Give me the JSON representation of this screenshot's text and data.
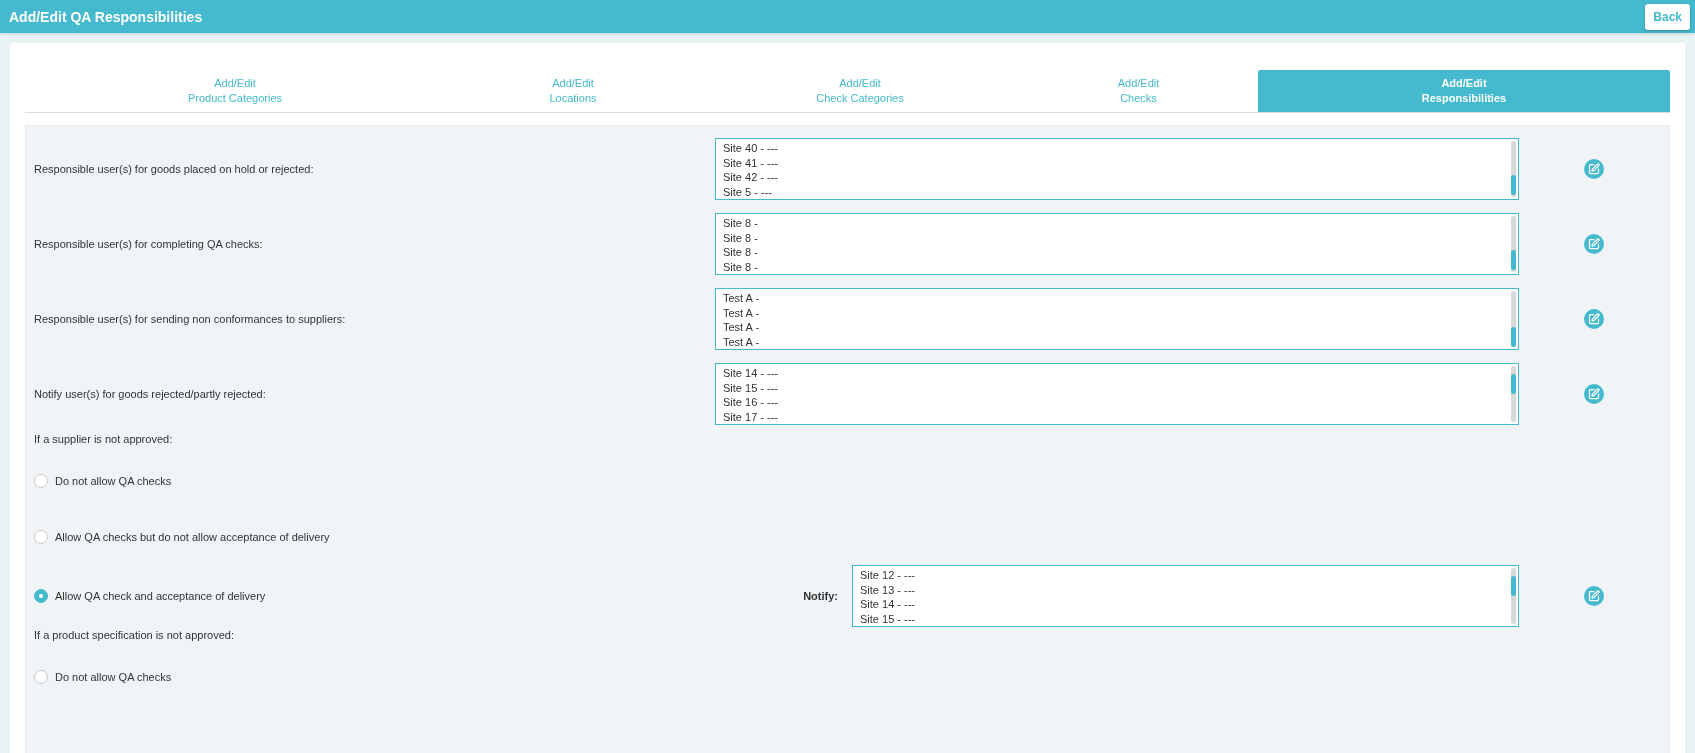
{
  "header": {
    "title": "Add/Edit QA Responsibilities",
    "back_button": "Back"
  },
  "tabs": [
    {
      "label": "Add/Edit\nProduct Categories",
      "selected": false
    },
    {
      "label": "Add/Edit\nLocations",
      "selected": false
    },
    {
      "label": "Add/Edit\nCheck Categories",
      "selected": false
    },
    {
      "label": "Add/Edit\nChecks",
      "selected": false
    },
    {
      "label": "Add/Edit\nResponsibilities",
      "selected": true
    }
  ],
  "responsibilities": [
    {
      "label": "Responsible user(s) for goods placed on hold or rejected:",
      "users": [
        "Site 40 - ---",
        "Site 41 - ---",
        "Site 42 - ---",
        "Site 5 - ---"
      ]
    },
    {
      "label": "Responsible user(s) for completing QA checks:",
      "users": [
        "Site 8 -",
        "Site 8 -",
        "Site 8 -",
        "Site 8 -"
      ]
    },
    {
      "label": "Responsible user(s) for sending non conformances to suppliers:",
      "users": [
        "Test A -",
        "Test A -",
        "Test A -",
        "Test A -"
      ]
    },
    {
      "label": "Notify user(s) for goods rejected/partly rejected:",
      "users": [
        "Site 14 - ---",
        "Site 15 - ---",
        "Site 16 - ---",
        "Site 17 - ---"
      ]
    }
  ],
  "approval_sections": [
    {
      "heading": "If a supplier is not approved:",
      "options": [
        {
          "label": "Do not allow QA checks",
          "selected": false
        },
        {
          "label": "Allow QA checks but do not allow acceptance of delivery",
          "selected": false
        },
        {
          "label": "Allow QA check and acceptance of delivery",
          "selected": true,
          "notify": {
            "label": "Notify:",
            "users": [
              "Site 12 - ---",
              "Site 13 - ---",
              "Site 14 - ---",
              "Site 15 - ---"
            ]
          }
        }
      ]
    },
    {
      "heading": "If a product specification is not approved:",
      "options": [
        {
          "label": "Do not allow QA checks",
          "selected": false
        }
      ]
    }
  ]
}
